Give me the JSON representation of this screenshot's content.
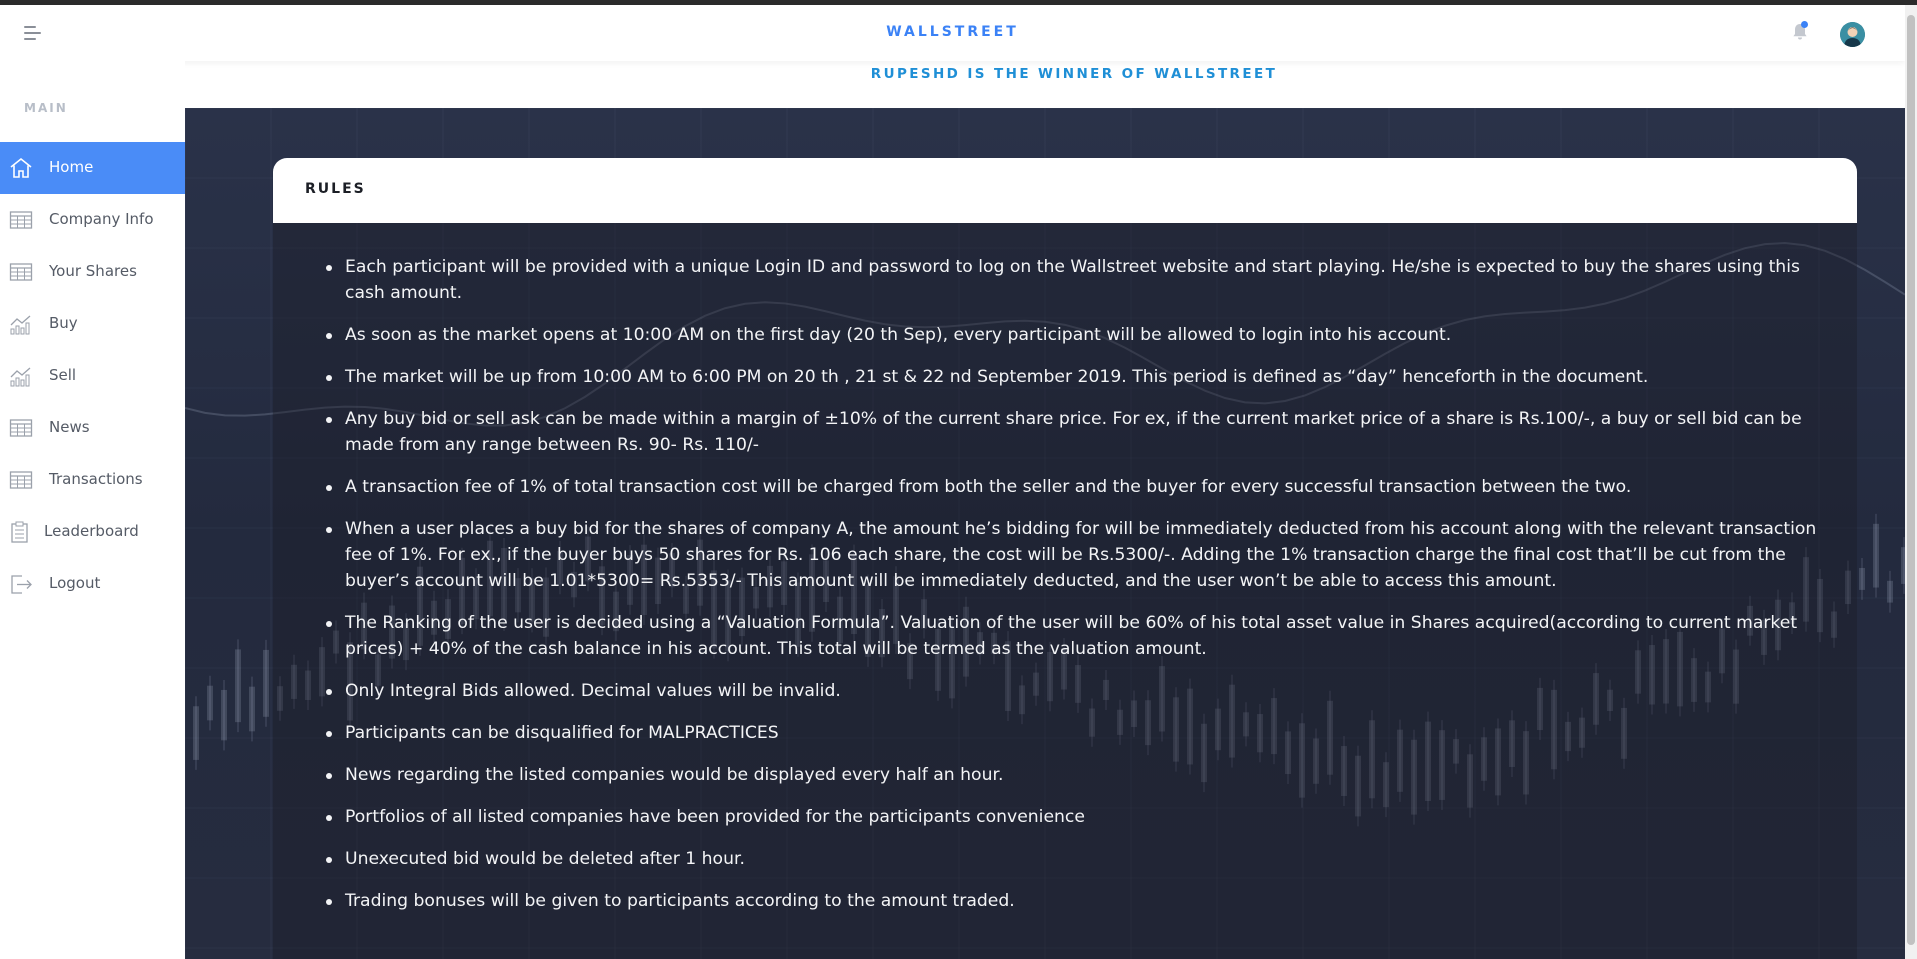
{
  "header": {
    "brand": "WALLSTREET",
    "winner_banner": "RUPESHD IS THE WINNER OF WALLSTREET"
  },
  "sidebar": {
    "section_label": "MAIN",
    "items": [
      {
        "label": "Home",
        "icon": "home-icon"
      },
      {
        "label": "Company Info",
        "icon": "table-icon"
      },
      {
        "label": "Your Shares",
        "icon": "table-icon"
      },
      {
        "label": "Buy",
        "icon": "chart-icon"
      },
      {
        "label": "Sell",
        "icon": "chart-icon"
      },
      {
        "label": "News",
        "icon": "table-icon"
      },
      {
        "label": "Transactions",
        "icon": "table-icon"
      },
      {
        "label": "Leaderboard",
        "icon": "clipboard-icon"
      },
      {
        "label": "Logout",
        "icon": "logout-icon"
      }
    ],
    "active": "Home"
  },
  "rules_card": {
    "title": "RULES",
    "items": [
      "Each participant will be provided with a unique Login ID and password to log on the Wallstreet website and start playing. He/she is expected to buy the shares using this cash amount.",
      "As soon as the market opens at 10:00 AM on the first day (20 th Sep), every participant will be allowed to login into his account.",
      "The market will be up from 10:00 AM to 6:00 PM on 20 th , 21 st & 22 nd September 2019. This period is defined as “day” henceforth in the document.",
      "Any buy bid or sell ask can be made within a margin of ±10% of the current share price. For ex, if the current market price of a share is Rs.100/-, a buy or sell bid can be made from any range between Rs. 90- Rs. 110/-",
      "A transaction fee of 1% of total transaction cost will be charged from both the seller and the buyer for every successful transaction between the two.",
      "When a user places a buy bid for the shares of company A, the amount he’s bidding for will be immediately deducted from his account along with the relevant transaction fee of 1%. For ex., if the buyer buys 50 shares for Rs. 106 each share, the cost will be Rs.5300/-. Adding the 1% transaction charge the final cost that’ll be cut from the buyer’s account will be 1.01*5300= Rs.5353/- This amount will be immediately deducted, and the user won’t be able to access this amount.",
      "The Ranking of the user is decided using a “Valuation Formula”. Valuation of the user will be 60% of his total asset value in Shares acquired(according to current market prices) + 40% of the cash balance in his account. This total will be termed as the valuation amount.",
      "Only Integral Bids allowed. Decimal values will be invalid.",
      "Participants can be disqualified for MALPRACTICES",
      "News regarding the listed companies would be displayed every half an hour.",
      "Portfolios of all listed companies have been provided for the participants convenience",
      "Unexecuted bid would be deleted after 1 hour.",
      "Trading bonuses will be given to participants according to the amount traded."
    ]
  },
  "colors": {
    "accent": "#4a8cf7",
    "brand": "#3b82f6",
    "banner": "#1f8fd6"
  }
}
